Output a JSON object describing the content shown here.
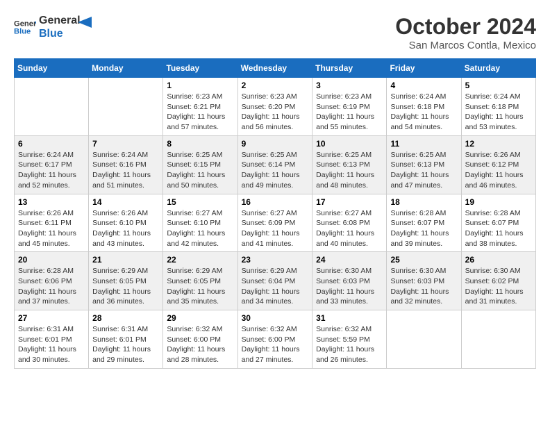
{
  "header": {
    "logo_general": "General",
    "logo_blue": "Blue",
    "month": "October 2024",
    "location": "San Marcos Contla, Mexico"
  },
  "days_of_week": [
    "Sunday",
    "Monday",
    "Tuesday",
    "Wednesday",
    "Thursday",
    "Friday",
    "Saturday"
  ],
  "weeks": [
    [
      {
        "day": "",
        "sunrise": "",
        "sunset": "",
        "daylight": ""
      },
      {
        "day": "",
        "sunrise": "",
        "sunset": "",
        "daylight": ""
      },
      {
        "day": "1",
        "sunrise": "Sunrise: 6:23 AM",
        "sunset": "Sunset: 6:21 PM",
        "daylight": "Daylight: 11 hours and 57 minutes."
      },
      {
        "day": "2",
        "sunrise": "Sunrise: 6:23 AM",
        "sunset": "Sunset: 6:20 PM",
        "daylight": "Daylight: 11 hours and 56 minutes."
      },
      {
        "day": "3",
        "sunrise": "Sunrise: 6:23 AM",
        "sunset": "Sunset: 6:19 PM",
        "daylight": "Daylight: 11 hours and 55 minutes."
      },
      {
        "day": "4",
        "sunrise": "Sunrise: 6:24 AM",
        "sunset": "Sunset: 6:18 PM",
        "daylight": "Daylight: 11 hours and 54 minutes."
      },
      {
        "day": "5",
        "sunrise": "Sunrise: 6:24 AM",
        "sunset": "Sunset: 6:18 PM",
        "daylight": "Daylight: 11 hours and 53 minutes."
      }
    ],
    [
      {
        "day": "6",
        "sunrise": "Sunrise: 6:24 AM",
        "sunset": "Sunset: 6:17 PM",
        "daylight": "Daylight: 11 hours and 52 minutes."
      },
      {
        "day": "7",
        "sunrise": "Sunrise: 6:24 AM",
        "sunset": "Sunset: 6:16 PM",
        "daylight": "Daylight: 11 hours and 51 minutes."
      },
      {
        "day": "8",
        "sunrise": "Sunrise: 6:25 AM",
        "sunset": "Sunset: 6:15 PM",
        "daylight": "Daylight: 11 hours and 50 minutes."
      },
      {
        "day": "9",
        "sunrise": "Sunrise: 6:25 AM",
        "sunset": "Sunset: 6:14 PM",
        "daylight": "Daylight: 11 hours and 49 minutes."
      },
      {
        "day": "10",
        "sunrise": "Sunrise: 6:25 AM",
        "sunset": "Sunset: 6:13 PM",
        "daylight": "Daylight: 11 hours and 48 minutes."
      },
      {
        "day": "11",
        "sunrise": "Sunrise: 6:25 AM",
        "sunset": "Sunset: 6:13 PM",
        "daylight": "Daylight: 11 hours and 47 minutes."
      },
      {
        "day": "12",
        "sunrise": "Sunrise: 6:26 AM",
        "sunset": "Sunset: 6:12 PM",
        "daylight": "Daylight: 11 hours and 46 minutes."
      }
    ],
    [
      {
        "day": "13",
        "sunrise": "Sunrise: 6:26 AM",
        "sunset": "Sunset: 6:11 PM",
        "daylight": "Daylight: 11 hours and 45 minutes."
      },
      {
        "day": "14",
        "sunrise": "Sunrise: 6:26 AM",
        "sunset": "Sunset: 6:10 PM",
        "daylight": "Daylight: 11 hours and 43 minutes."
      },
      {
        "day": "15",
        "sunrise": "Sunrise: 6:27 AM",
        "sunset": "Sunset: 6:10 PM",
        "daylight": "Daylight: 11 hours and 42 minutes."
      },
      {
        "day": "16",
        "sunrise": "Sunrise: 6:27 AM",
        "sunset": "Sunset: 6:09 PM",
        "daylight": "Daylight: 11 hours and 41 minutes."
      },
      {
        "day": "17",
        "sunrise": "Sunrise: 6:27 AM",
        "sunset": "Sunset: 6:08 PM",
        "daylight": "Daylight: 11 hours and 40 minutes."
      },
      {
        "day": "18",
        "sunrise": "Sunrise: 6:28 AM",
        "sunset": "Sunset: 6:07 PM",
        "daylight": "Daylight: 11 hours and 39 minutes."
      },
      {
        "day": "19",
        "sunrise": "Sunrise: 6:28 AM",
        "sunset": "Sunset: 6:07 PM",
        "daylight": "Daylight: 11 hours and 38 minutes."
      }
    ],
    [
      {
        "day": "20",
        "sunrise": "Sunrise: 6:28 AM",
        "sunset": "Sunset: 6:06 PM",
        "daylight": "Daylight: 11 hours and 37 minutes."
      },
      {
        "day": "21",
        "sunrise": "Sunrise: 6:29 AM",
        "sunset": "Sunset: 6:05 PM",
        "daylight": "Daylight: 11 hours and 36 minutes."
      },
      {
        "day": "22",
        "sunrise": "Sunrise: 6:29 AM",
        "sunset": "Sunset: 6:05 PM",
        "daylight": "Daylight: 11 hours and 35 minutes."
      },
      {
        "day": "23",
        "sunrise": "Sunrise: 6:29 AM",
        "sunset": "Sunset: 6:04 PM",
        "daylight": "Daylight: 11 hours and 34 minutes."
      },
      {
        "day": "24",
        "sunrise": "Sunrise: 6:30 AM",
        "sunset": "Sunset: 6:03 PM",
        "daylight": "Daylight: 11 hours and 33 minutes."
      },
      {
        "day": "25",
        "sunrise": "Sunrise: 6:30 AM",
        "sunset": "Sunset: 6:03 PM",
        "daylight": "Daylight: 11 hours and 32 minutes."
      },
      {
        "day": "26",
        "sunrise": "Sunrise: 6:30 AM",
        "sunset": "Sunset: 6:02 PM",
        "daylight": "Daylight: 11 hours and 31 minutes."
      }
    ],
    [
      {
        "day": "27",
        "sunrise": "Sunrise: 6:31 AM",
        "sunset": "Sunset: 6:01 PM",
        "daylight": "Daylight: 11 hours and 30 minutes."
      },
      {
        "day": "28",
        "sunrise": "Sunrise: 6:31 AM",
        "sunset": "Sunset: 6:01 PM",
        "daylight": "Daylight: 11 hours and 29 minutes."
      },
      {
        "day": "29",
        "sunrise": "Sunrise: 6:32 AM",
        "sunset": "Sunset: 6:00 PM",
        "daylight": "Daylight: 11 hours and 28 minutes."
      },
      {
        "day": "30",
        "sunrise": "Sunrise: 6:32 AM",
        "sunset": "Sunset: 6:00 PM",
        "daylight": "Daylight: 11 hours and 27 minutes."
      },
      {
        "day": "31",
        "sunrise": "Sunrise: 6:32 AM",
        "sunset": "Sunset: 5:59 PM",
        "daylight": "Daylight: 11 hours and 26 minutes."
      },
      {
        "day": "",
        "sunrise": "",
        "sunset": "",
        "daylight": ""
      },
      {
        "day": "",
        "sunrise": "",
        "sunset": "",
        "daylight": ""
      }
    ]
  ]
}
